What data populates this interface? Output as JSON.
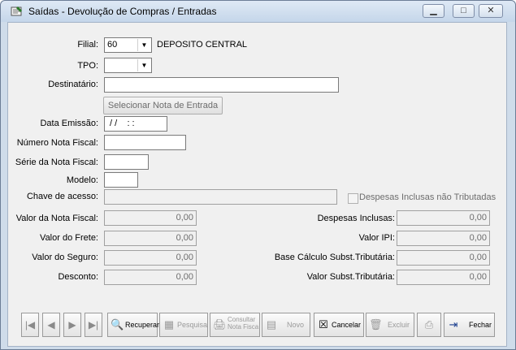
{
  "window": {
    "title": "Saídas - Devolução de Compras / Entradas"
  },
  "form": {
    "filial_label": "Filial:",
    "filial_value": "60",
    "filial_name": "DEPOSITO CENTRAL",
    "tpo_label": "TPO:",
    "tpo_value": "",
    "destinatario_label": "Destinatário:",
    "destinatario_value": "",
    "selecionar_nota_label": "Selecionar Nota de Entrada",
    "data_emissao_label": "Data Emissão:",
    "data_emissao_value": " / /    : :",
    "numero_nota_label": "Número Nota Fiscal:",
    "serie_nota_label": "Série da Nota Fiscal:",
    "modelo_label": "Modelo:",
    "chave_acesso_label": "Chave de acesso:",
    "despesas_nao_trib_label": "Despesas Inclusas não Tributadas",
    "valor_nota_label": "Valor da Nota Fiscal:",
    "valor_nota_value": "0,00",
    "valor_frete_label": "Valor do Frete:",
    "valor_frete_value": "0,00",
    "valor_seguro_label": "Valor do Seguro:",
    "valor_seguro_value": "0,00",
    "desconto_label": "Desconto:",
    "desconto_value": "0,00",
    "despesas_inclusas_label": "Despesas Inclusas:",
    "despesas_inclusas_value": "0,00",
    "valor_ipi_label": "Valor IPI:",
    "valor_ipi_value": "0,00",
    "base_calculo_label": "Base Cálculo Subst.Tributária:",
    "base_calculo_value": "0,00",
    "valor_subst_label": "Valor Subst.Tributária:",
    "valor_subst_value": "0,00"
  },
  "toolbar": {
    "recuperar": "Recuperar",
    "pesquisa": "Pesquisa",
    "consultar_line1": "Consultar",
    "consultar_line2": "Nota Fisca",
    "novo": "Novo",
    "cancelar": "Cancelar",
    "excluir": "Excluir",
    "fechar": "Fechar"
  }
}
